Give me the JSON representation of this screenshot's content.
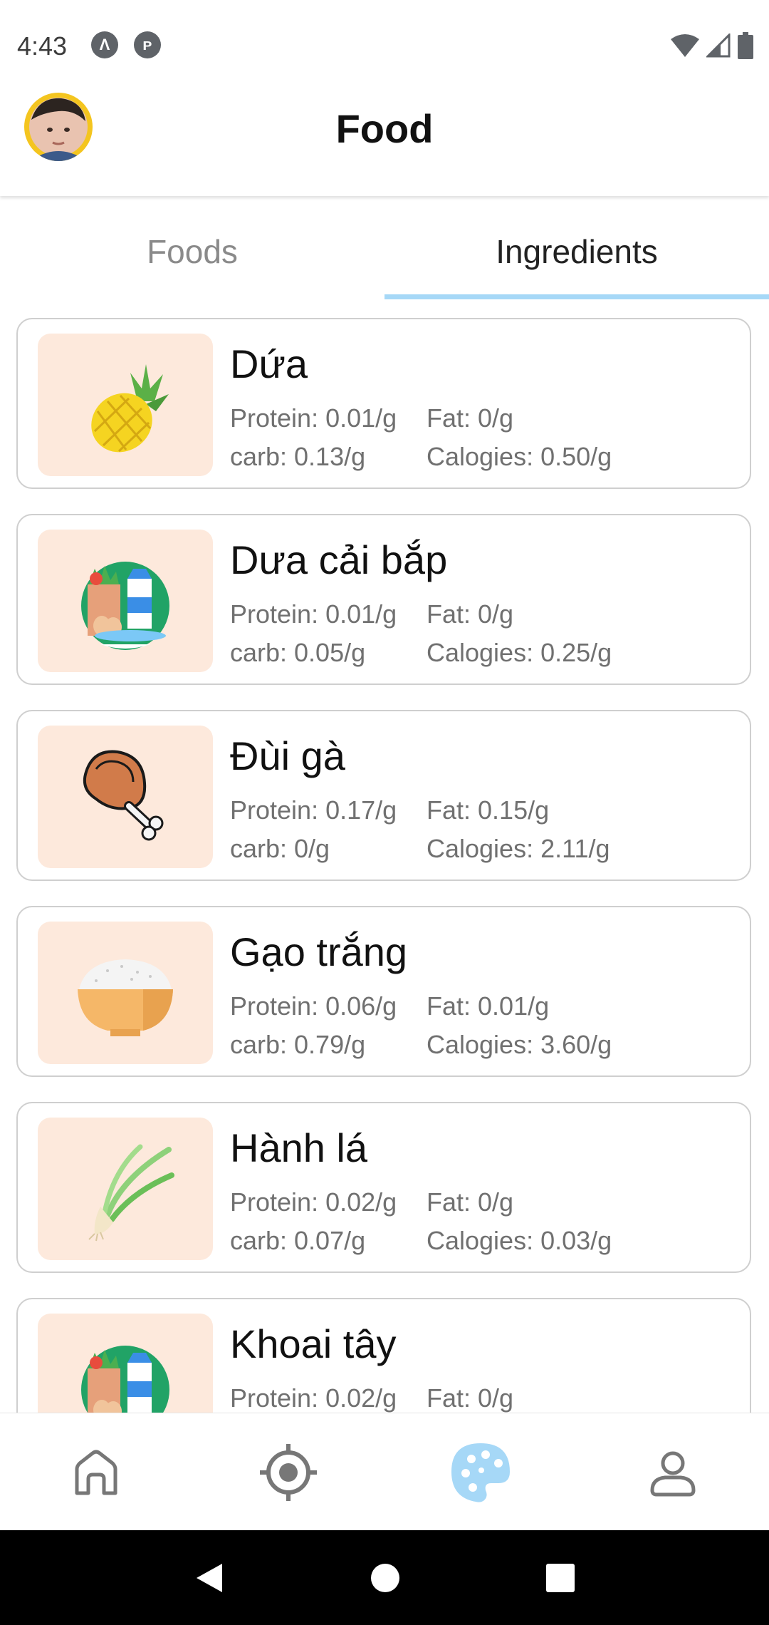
{
  "status_bar": {
    "time": "4:43"
  },
  "header": {
    "title": "Food",
    "avatar_alt": "user-avatar"
  },
  "tabs": [
    {
      "label": "Foods",
      "active": false
    },
    {
      "label": "Ingredients",
      "active": true
    }
  ],
  "ingredients": [
    {
      "name": "Dứa",
      "protein": "Protein: 0.01/g",
      "fat": "Fat: 0/g",
      "carb": "carb: 0.13/g",
      "calories": "Calogies: 0.50/g",
      "icon": "pineapple-icon"
    },
    {
      "name": "Dưa cải bắp",
      "protein": "Protein: 0.01/g",
      "fat": "Fat: 0/g",
      "carb": "carb: 0.05/g",
      "calories": "Calogies: 0.25/g",
      "icon": "groceries-icon"
    },
    {
      "name": "Đùi gà",
      "protein": "Protein: 0.17/g",
      "fat": "Fat: 0.15/g",
      "carb": "carb: 0/g",
      "calories": "Calogies: 2.11/g",
      "icon": "chicken-leg-icon"
    },
    {
      "name": "Gạo trắng",
      "protein": "Protein: 0.06/g",
      "fat": "Fat: 0.01/g",
      "carb": "carb: 0.79/g",
      "calories": "Calogies: 3.60/g",
      "icon": "rice-bowl-icon"
    },
    {
      "name": "Hành lá",
      "protein": "Protein: 0.02/g",
      "fat": "Fat: 0/g",
      "carb": "carb: 0.07/g",
      "calories": "Calogies: 0.03/g",
      "icon": "green-onion-icon"
    },
    {
      "name": "Khoai tây",
      "protein": "Protein: 0.02/g",
      "fat": "Fat: 0/g",
      "carb": "",
      "calories": "",
      "icon": "groceries-icon"
    }
  ],
  "bottom_nav": [
    {
      "icon": "home-icon",
      "active": false
    },
    {
      "icon": "target-icon",
      "active": false
    },
    {
      "icon": "palette-icon",
      "active": true
    },
    {
      "icon": "profile-icon",
      "active": false
    }
  ],
  "colors": {
    "accent": "#a6d8f7",
    "thumb_bg": "#fde9dc",
    "avatar_ring": "#f4c51f"
  }
}
